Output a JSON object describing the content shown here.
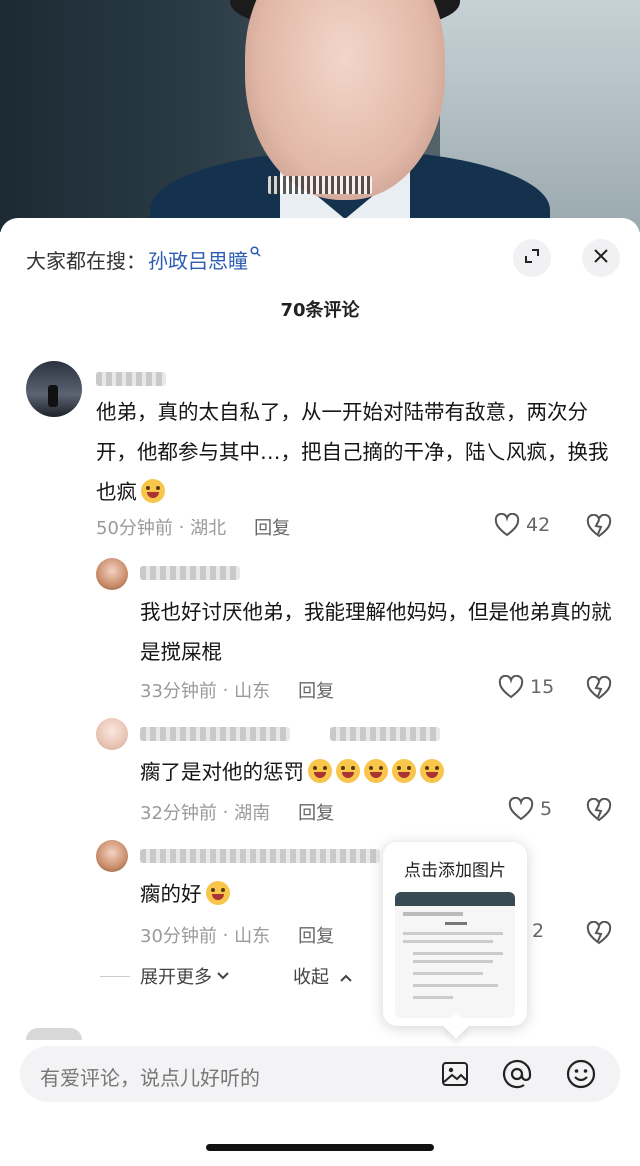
{
  "search": {
    "prefix": "大家都在搜：",
    "term": "孙政吕思瞳"
  },
  "header": {
    "comment_count": "70条评论"
  },
  "comments": [
    {
      "text": "他弟，真的太自私了，从一开始对陆带有敌意，两次分开，他都参与其中…，把自己摘的干净，陆乀风疯，换我也疯",
      "time": "50分钟前",
      "location": "湖北",
      "reply_label": "回复",
      "likes": "42"
    },
    {
      "text": "我也好讨厌他弟，我能理解他妈妈，但是他弟真的就是搅屎棍",
      "time": "33分钟前",
      "location": "山东",
      "reply_label": "回复",
      "likes": "15"
    },
    {
      "text": "瘸了是对他的惩罚",
      "time": "32分钟前",
      "location": "湖南",
      "reply_label": "回复",
      "likes": "5"
    },
    {
      "text": "瘸的好",
      "time": "30分钟前",
      "location": "山东",
      "reply_label": "回复",
      "likes": "2"
    }
  ],
  "replies_controls": {
    "expand": "展开更多",
    "collapse": "收起"
  },
  "tooltip": {
    "title": "点击添加图片"
  },
  "input": {
    "placeholder": "有爱评论，说点儿好听的"
  },
  "icons": [
    "search-icon",
    "expand-icon",
    "close-icon",
    "heart-icon",
    "dislike-icon",
    "image-icon",
    "at-icon",
    "emoji-icon"
  ]
}
